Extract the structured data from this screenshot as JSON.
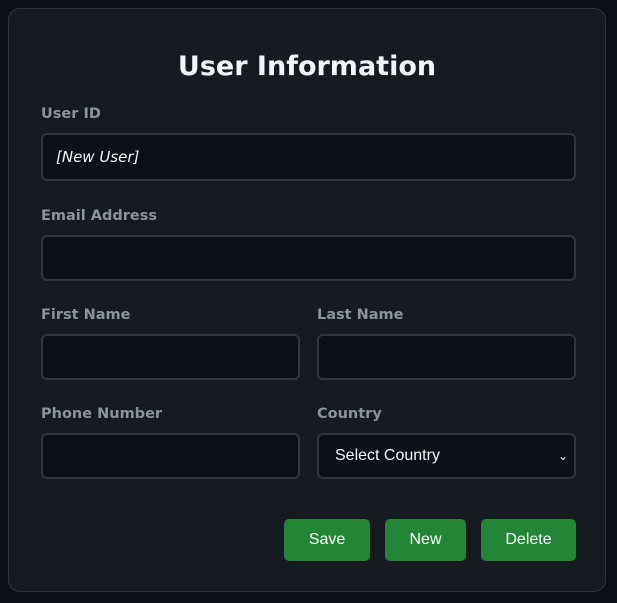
{
  "form": {
    "title": "User Information",
    "user_id": {
      "label": "User ID",
      "value": "[New User]"
    },
    "email": {
      "label": "Email Address",
      "value": ""
    },
    "first_name": {
      "label": "First Name",
      "value": ""
    },
    "last_name": {
      "label": "Last Name",
      "value": ""
    },
    "phone": {
      "label": "Phone Number",
      "value": ""
    },
    "country": {
      "label": "Country",
      "selected": "Select Country"
    }
  },
  "buttons": {
    "save": "Save",
    "new": "New",
    "delete": "Delete"
  },
  "colors": {
    "accent": "#238636",
    "background": "#0d1117",
    "card": "#161b22"
  }
}
